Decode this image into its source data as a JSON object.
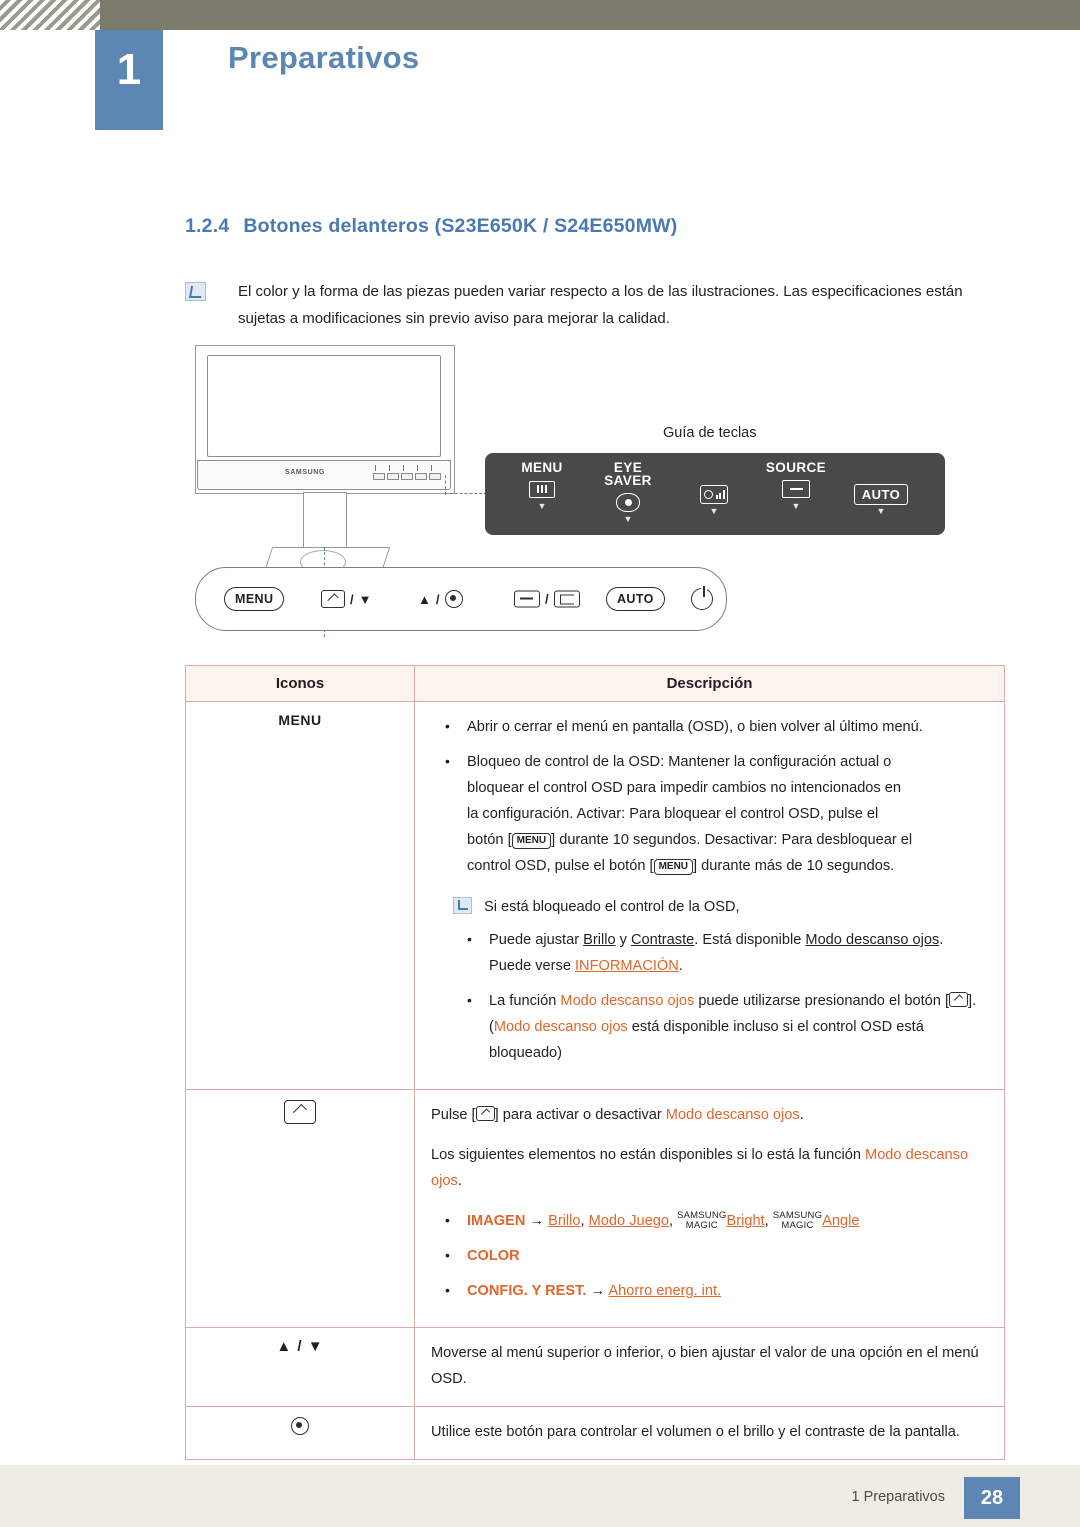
{
  "header": {
    "chapter_number": "1",
    "chapter_title": "Preparativos"
  },
  "section": {
    "number": "1.2.4",
    "title": "Botones delanteros (S23E650K / S24E650MW)"
  },
  "note": {
    "text": "El color y la forma de las piezas pueden variar respecto a los de las ilustraciones. Las especificaciones están sujetas a modificaciones sin previo aviso para mejorar la calidad."
  },
  "figure": {
    "monitor_logo": "SAMSUNG",
    "guide_label": "Guía de teclas",
    "key_guide": [
      {
        "label": "MENU",
        "icon": "menu-bars-icon"
      },
      {
        "label_line1": "EYE",
        "label_line2": "SAVER",
        "icon": "eye-saver-icon"
      },
      {
        "label": "",
        "icon": "brightness-icon"
      },
      {
        "label": "SOURCE",
        "icon": "source-icon"
      },
      {
        "label": "AUTO",
        "icon": "auto-icon"
      }
    ],
    "button_bar": {
      "menu": "MENU",
      "auto": "AUTO",
      "separator": "/"
    }
  },
  "table": {
    "headers": [
      "Iconos",
      "Descripción"
    ],
    "rows": [
      {
        "icon_label": "MENU",
        "bullets": [
          "Abrir o cerrar el menú en pantalla (OSD), o bien volver al último menú.",
          "Bloqueo de control de la OSD: Mantener la configuración actual o bloquear el control OSD para impedir cambios no intencionados en la configuración. Activar: Para bloquear el control OSD, pulse el botón [MENU] durante 10 segundos. Desactivar: Para desbloquear el control OSD, pulse el botón [MENU] durante más de 10 segundos."
        ],
        "bullet2_parts": {
          "p1": "Bloqueo de control de la OSD: Mantener la configuración actual o",
          "p2": "bloquear el control OSD para impedir cambios no intencionados en",
          "p3": "la configuración. Activar: Para bloquear el control OSD, pulse el",
          "p4_pre": "botón [",
          "p4_btn": "MENU",
          "p4_post": "] durante 10 segundos. Desactivar: Para desbloquear el",
          "p5_pre": "control OSD, pulse el botón [",
          "p5_btn": "MENU",
          "p5_post": "] durante más de 10 segundos."
        },
        "inner_note": "Si está bloqueado el control de la OSD,",
        "sub_bullets": [
          {
            "pre": "Puede ajustar ",
            "hl1": "Brillo",
            "mid": " y ",
            "hl2": "Contraste",
            "mid2": ". Está disponible ",
            "hl3": "Modo descanso ojos",
            "mid3": ". Puede verse ",
            "hl4": "INFORMACIÓN",
            "post": "."
          },
          {
            "pre": "La función ",
            "hl1": "Modo descanso ojos",
            "mid": " puede utilizarse presionando el botón [",
            "icon": "eye-saver-icon",
            "mid2": "]. (",
            "hl2": "Modo descanso ojos",
            "post": " está disponible incluso si el control OSD está bloqueado)"
          }
        ]
      },
      {
        "icon_label": "",
        "icon_name": "eye-saver-icon",
        "line1_pre": "Pulse [",
        "line1_mid": "] para activar o desactivar ",
        "line1_hl": "Modo descanso ojos",
        "line1_post": ".",
        "line2_pre": "Los siguientes elementos no están disponibles si lo está la función ",
        "line2_hl": "Modo descanso ojos",
        "line2_post": ".",
        "items": [
          {
            "t1": "IMAGEN",
            "arrow": "→",
            "t2": "Brillo",
            "sep": ", ",
            "t3": "Modo Juego",
            "sep2": ", ",
            "sup1": "SAMSUNG",
            "sub1": "MAGIC",
            "t4": "Bright",
            "sep3": ", ",
            "sup2": "SAMSUNG",
            "sub2": "MAGIC",
            "t5": "Angle"
          },
          {
            "t1": "COLOR"
          },
          {
            "t1": "CONFIG. Y REST.",
            "arrow": "→",
            "t2": "Ahorro energ. int."
          }
        ]
      },
      {
        "icon_label": "▲ / ▼",
        "desc": "Moverse al menú superior o inferior, o bien ajustar el valor de una opción en el menú OSD."
      },
      {
        "icon_label": "",
        "icon_name": "circle-dot-icon",
        "desc": "Utilice este botón para controlar el volumen o el brillo y el contraste de la pantalla."
      }
    ]
  },
  "footer": {
    "text": "1 Preparativos",
    "page": "28"
  }
}
